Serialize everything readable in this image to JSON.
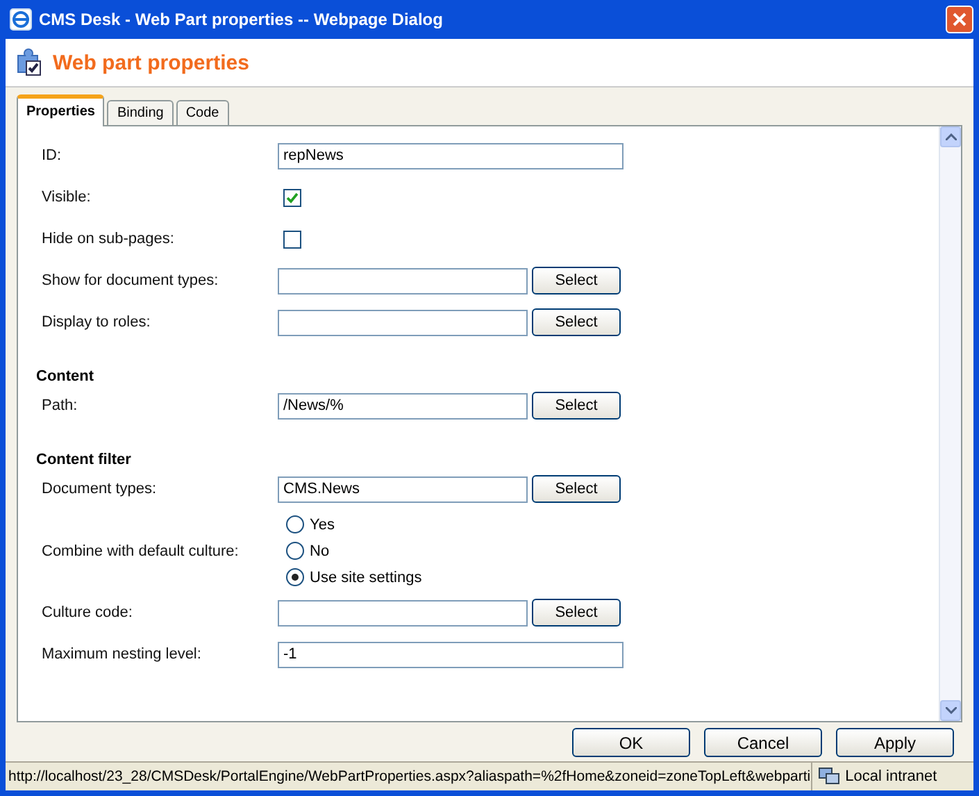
{
  "window": {
    "title": "CMS Desk - Web Part properties -- Webpage Dialog"
  },
  "header": {
    "title": "Web part properties"
  },
  "tabs": [
    {
      "label": "Properties",
      "selected": true
    },
    {
      "label": "Binding",
      "selected": false
    },
    {
      "label": "Code",
      "selected": false
    }
  ],
  "form": [
    {
      "kind": "text",
      "label": "ID:",
      "value": "repNews"
    },
    {
      "kind": "checkbox",
      "label": "Visible:",
      "checked": true
    },
    {
      "kind": "checkbox",
      "label": "Hide on sub-pages:",
      "checked": false
    },
    {
      "kind": "picker",
      "label": "Show for document types:",
      "button": "Select"
    },
    {
      "kind": "picker",
      "label": "Display to roles:",
      "button": "Select"
    },
    {
      "kind": "heading",
      "label": "Content"
    },
    {
      "kind": "picker",
      "label": "Path:",
      "value": "/News/%",
      "button": "Select"
    },
    {
      "kind": "heading",
      "label": "Content filter"
    },
    {
      "kind": "picker",
      "label": "Document types:",
      "value": "CMS.News",
      "button": "Select"
    },
    {
      "kind": "radios",
      "label": "Combine with default culture:",
      "options": [
        {
          "label": "Yes",
          "selected": false
        },
        {
          "label": "No",
          "selected": false
        },
        {
          "label": "Use site settings",
          "selected": true
        }
      ]
    },
    {
      "kind": "picker",
      "label": "Culture code:",
      "button": "Select"
    },
    {
      "kind": "text",
      "label": "Maximum nesting level:",
      "value": "-1"
    }
  ],
  "buttons": [
    "OK",
    "Cancel",
    "Apply"
  ],
  "status_bar": {
    "url": "http://localhost/23_28/CMSDesk/PortalEngine/WebPartProperties.aspx?aliaspath=%2fHome&zoneid=zoneTopLeft&webparti",
    "zone": "Local intranet"
  }
}
